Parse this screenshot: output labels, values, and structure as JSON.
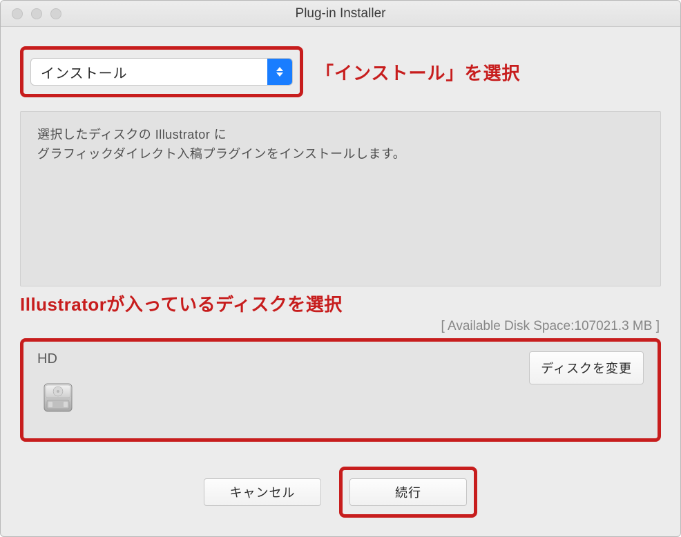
{
  "window": {
    "title": "Plug-in Installer"
  },
  "dropdown": {
    "selected": "インストール"
  },
  "annotations": {
    "select_install": "「インストール」を選択",
    "select_disk": "Illustratorが入っているディスクを選択"
  },
  "info": {
    "line1": "選択したディスクの Illustrator に",
    "line2": "グラフィックダイレクト入稿プラグインをインストールします。"
  },
  "disk": {
    "space_label": "[ Available Disk Space:107021.3 MB ]",
    "name": "HD",
    "change_button": "ディスクを変更"
  },
  "buttons": {
    "cancel": "キャンセル",
    "continue": "続行"
  }
}
